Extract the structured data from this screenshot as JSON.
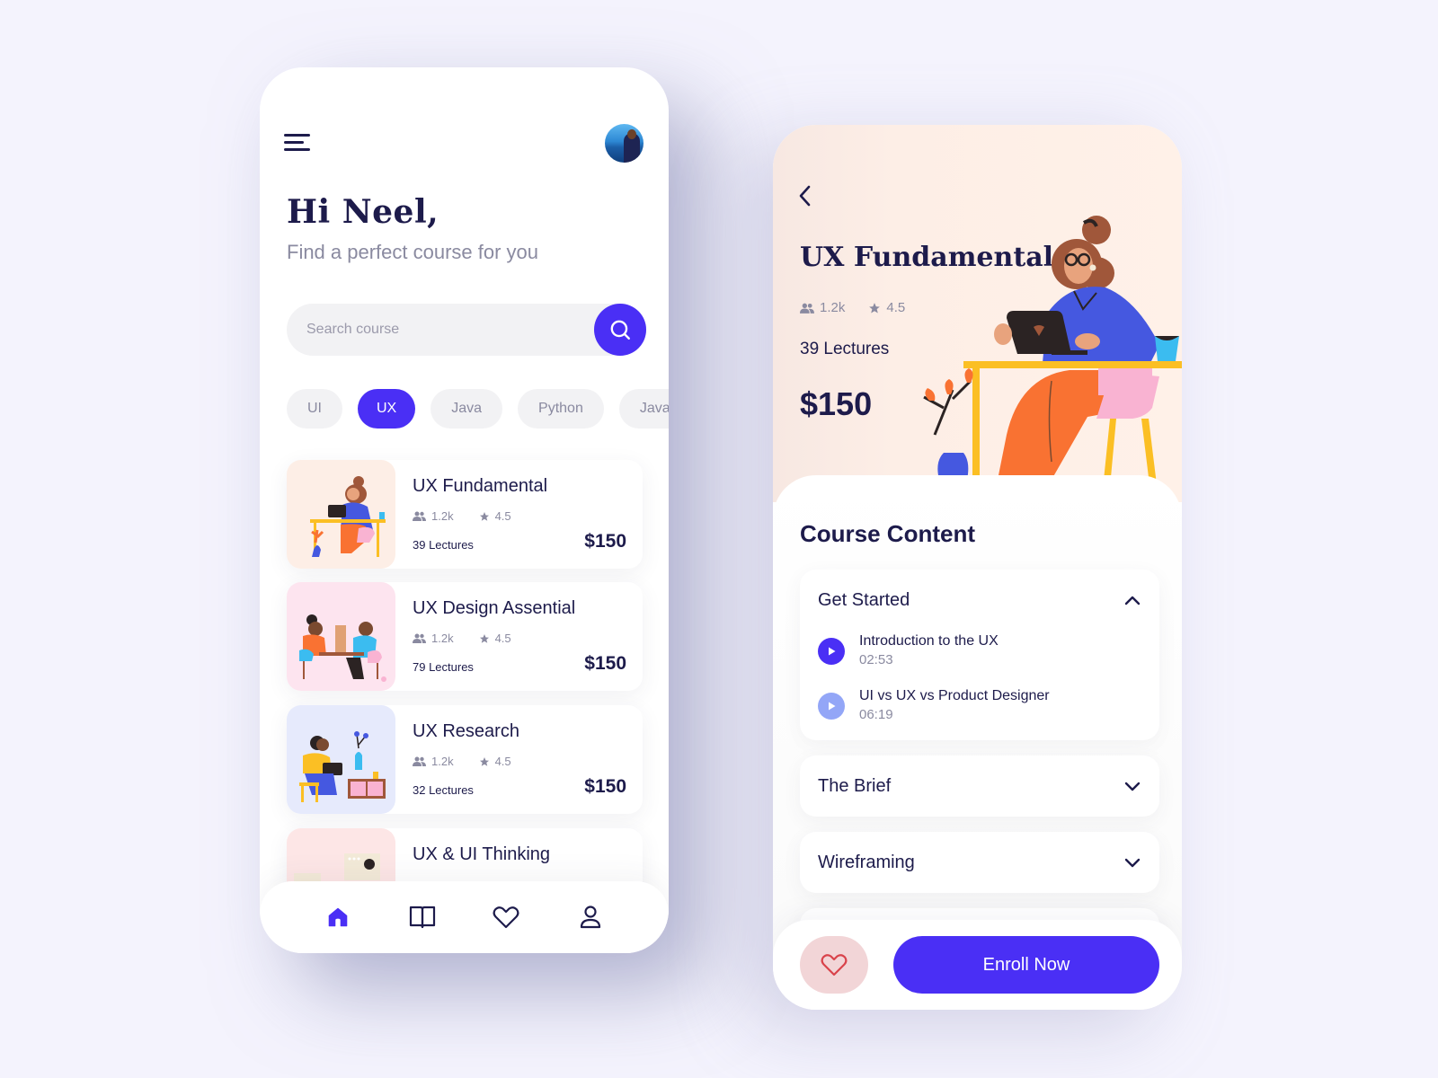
{
  "home": {
    "greeting": "Hi Neel,",
    "subtitle": "Find a perfect course for you",
    "search": {
      "placeholder": "Search course",
      "value": ""
    },
    "categories": [
      {
        "label": "UI",
        "active": false
      },
      {
        "label": "UX",
        "active": true
      },
      {
        "label": "Java",
        "active": false
      },
      {
        "label": "Python",
        "active": false
      },
      {
        "label": "Java",
        "active": false
      }
    ],
    "courses": [
      {
        "title": "UX Fundamental",
        "students": "1.2k",
        "rating": "4.5",
        "lectures": "39 Lectures",
        "price": "$150",
        "thumb_color": "#fdeee6"
      },
      {
        "title": "UX Design Assential",
        "students": "1.2k",
        "rating": "4.5",
        "lectures": "79 Lectures",
        "price": "$150",
        "thumb_color": "#fde4ef"
      },
      {
        "title": "UX Research",
        "students": "1.2k",
        "rating": "4.5",
        "lectures": "32 Lectures",
        "price": "$150",
        "thumb_color": "#e6eafc"
      },
      {
        "title": "UX & UI Thinking",
        "students": "",
        "rating": "",
        "lectures": "",
        "price": "",
        "thumb_color": "#fde6e6"
      }
    ],
    "nav": [
      {
        "name": "home",
        "icon": "home-icon",
        "active": true
      },
      {
        "name": "library",
        "icon": "book-icon",
        "active": false
      },
      {
        "name": "favorites",
        "icon": "heart-icon",
        "active": false
      },
      {
        "name": "profile",
        "icon": "user-icon",
        "active": false
      }
    ]
  },
  "detail": {
    "title": "UX Fundamental",
    "students": "1.2k",
    "rating": "4.5",
    "lectures": "39 Lectures",
    "price": "$150",
    "content_heading": "Course Content",
    "sections": [
      {
        "title": "Get Started",
        "expanded": true,
        "lessons": [
          {
            "title": "Introduction to the UX",
            "duration": "02:53",
            "active": true
          },
          {
            "title": "UI vs UX vs Product Designer",
            "duration": "06:19",
            "active": false
          }
        ]
      },
      {
        "title": "The Brief",
        "expanded": false
      },
      {
        "title": "Wireframing",
        "expanded": false
      }
    ],
    "enroll_label": "Enroll Now"
  },
  "colors": {
    "accent": "#4a2ff5",
    "accent_light": "#93a6f7",
    "text_dark": "#1d1b4b",
    "text_muted": "#8a8aa0",
    "fav_bg": "#f2d5d7",
    "fav_icon": "#d9434b"
  }
}
